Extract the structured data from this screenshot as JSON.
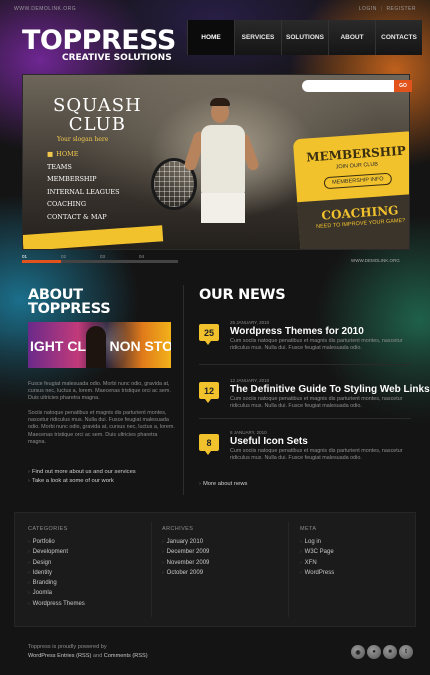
{
  "header": {
    "site_url": "WWW.DEMOLINK.ORG",
    "login": "LOGIN",
    "auth_sep": "|",
    "register": "REGISTER",
    "logo_title": "TOPPRESS",
    "logo_subtitle": "CREATIVE SOLUTIONS"
  },
  "nav": [
    {
      "label": "Home",
      "active": true
    },
    {
      "label": "Services"
    },
    {
      "label": "Solutions"
    },
    {
      "label": "About"
    },
    {
      "label": "Contacts"
    }
  ],
  "search": {
    "placeholder": "",
    "button": "GO"
  },
  "slider": {
    "title_line1": "SQUASH",
    "title_line2": "CLUB",
    "tagline": "Your slogan here",
    "menu": [
      "Home",
      "Teams",
      "Membership",
      "Internal Leagues",
      "Coaching",
      "Contact & Map"
    ],
    "membership": "MEMBERSHIP",
    "join": "JOIN OUR CLUB",
    "membership_info": "MEMBERSHIP INFO",
    "coaching": "COACHING",
    "improve": "NEED TO IMPROVE YOUR GAME?",
    "pages": [
      "01",
      "02",
      "03",
      "04"
    ],
    "active_page": 1,
    "demolink": "WWW.DEMOLINK.ORG"
  },
  "about": {
    "heading_line1": "ABOUT",
    "heading_line2": "TOPPRESS",
    "image_left_text": "IGHT CLUB",
    "image_right_text": "NON STO",
    "paragraph1": "Fusce feugiat malesuada odio. Morbi nunc odio, gravida at, cursus nec, luctus a, lorem. Maecenas tristique orci ac sem. Duis ultricies pharetra magna.",
    "paragraph2": "Sociis natoque penatibus et magnis dis parturient montes, nascetur ridiculus mus. Nulla dui. Fusce feugiat malesuada odio. Morbi nunc odio, gravida at, cursus nec, luctus a, lorem. Maecenas tristique orci ac sem. Duis ultricies pharetra magna.",
    "links": [
      "Find out more about us and our services",
      "Take a look at some of our work"
    ]
  },
  "news": {
    "heading": "OUR NEWS",
    "items": [
      {
        "day": "25",
        "date": "25 JANUARY, 2010",
        "title": "Wordpress Themes for 2010",
        "text": "Cum sociis natoque penatibus et magnis dis parturient montes, nascetur ridiculus mus. Nulla dui. Fusce feugiat malesuada odio."
      },
      {
        "day": "12",
        "date": "12 JANUARY, 2010",
        "title": "The Definitive Guide To Styling Web Links",
        "text": "Cum sociis natoque penatibus et magnis dis parturient montes, nascetur ridiculus mus. Nulla dui. Fusce feugiat malesuada odio."
      },
      {
        "day": "8",
        "date": "8 JANUARY, 2010",
        "title": "Useful Icon Sets",
        "text": "Cum sociis natoque penatibus et magnis dis parturient montes, nascetur ridiculus mus. Nulla dui. Fusce feugiat malesuada odio."
      }
    ],
    "more": "More about news"
  },
  "footer": {
    "categories": {
      "title": "CATEGORIES",
      "items": [
        "Portfolio",
        "Development",
        "Design",
        "Identity",
        "Branding",
        "Joomla",
        "Wordpress Themes"
      ]
    },
    "archives": {
      "title": "ARCHIVES",
      "items": [
        "January 2010",
        "December 2009",
        "November 2009",
        "October 2009"
      ]
    },
    "meta": {
      "title": "META",
      "items": [
        "Log in",
        "W3C Page",
        "XFN",
        "WordPress"
      ]
    },
    "powered_line1": "Toppress is proudly powered by",
    "powered_entries": "WordPress Entries (RSS)",
    "powered_and": "and",
    "powered_comments": "Comments (RSS)",
    "social": [
      "rss-icon",
      "flickr-icon",
      "delicious-icon",
      "twitter-icon"
    ]
  },
  "colors": {
    "accent_orange": "#e2531c",
    "accent_yellow": "#f2c22d",
    "background": "#141414"
  }
}
